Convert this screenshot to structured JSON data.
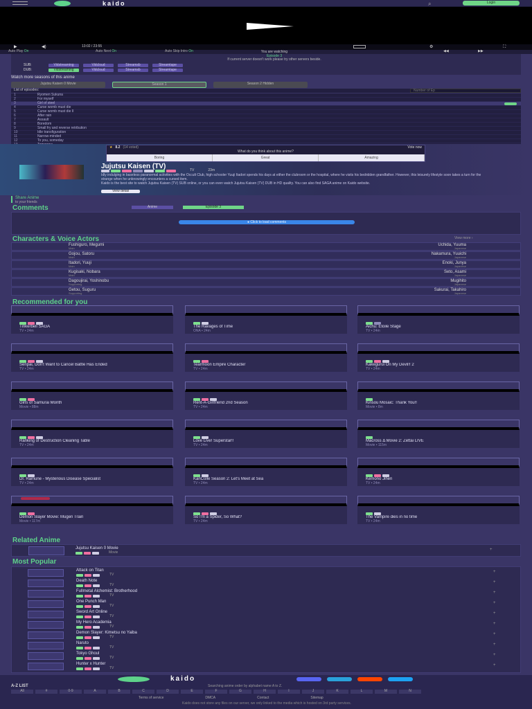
{
  "header": {
    "logo": "kaido",
    "login": "Login"
  },
  "player": {
    "time": "13:02 / 23:55"
  },
  "autobar": {
    "auto_play": "Auto Play",
    "auto_play_val": "On",
    "auto_next": "Auto Next",
    "auto_next_val": "On",
    "auto_skip": "Auto Skip Intro",
    "auto_skip_val": "On"
  },
  "servers": {
    "watching": "You are watching",
    "episode": "Episode 3",
    "note": "If current server doesn't work please try other servers beside.",
    "sub_label": "SUB:",
    "dub_label": "DUB:",
    "sub": [
      "Vidstreaming",
      "Vidcloud",
      "Streamsb",
      "Streamtape"
    ],
    "dub": [
      "Vidstreaming",
      "Vidcloud",
      "Streamsb",
      "Streamtape"
    ]
  },
  "seasons": {
    "title": "Watch more seasons of this anime",
    "items": [
      "Jujutsu Kaisen 0 Movie",
      "Season 1",
      "Season 2 Hidden"
    ]
  },
  "episodes": {
    "title": "List of episodes:",
    "search_placeholder": "Number of Ep",
    "items": [
      {
        "n": "1",
        "t": "Ryomen Sukuna"
      },
      {
        "n": "2",
        "t": "For myself"
      },
      {
        "n": "3",
        "t": "Girl of steel"
      },
      {
        "n": "4",
        "t": "Curse womb must die"
      },
      {
        "n": "5",
        "t": "Curse womb must die II"
      },
      {
        "n": "6",
        "t": "After rain"
      },
      {
        "n": "7",
        "t": "Assault"
      },
      {
        "n": "8",
        "t": "Boredom"
      },
      {
        "n": "9",
        "t": "Small fry and reverse retribution"
      },
      {
        "n": "10",
        "t": "Idle transfiguration"
      },
      {
        "n": "11",
        "t": "Narrow-minded"
      },
      {
        "n": "12",
        "t": "To you, someday"
      },
      {
        "n": "13",
        "t": "Tomorrow"
      },
      {
        "n": "14",
        "t": "Kyoto sister school exchange event - group battle 0 -"
      }
    ]
  },
  "anime": {
    "title": "Jujutsu Kaisen (TV)",
    "type": "TV",
    "duration": "23m",
    "desc": "Idly indulging in baseless paranormal activities with the Occult Club, high schooler Yuuji Itadori spends his days at either the clubroom or the hospital, where he visits his bedridden grandfather. However, this leisurely lifestyle soon takes a turn for the strange when he unknowingly encounters a cursed item.",
    "desc2": "Kaido is the best site to watch Jujutsu Kaisen (TV) SUB online, or you can even watch Jujutsu Kaisen (TV) DUB in HD quality. You can also find SAGA anime on Kaido website.",
    "view": "View detail"
  },
  "vote": {
    "score": "8.2",
    "voted": "(14 voted)",
    "question": "What do you think about this anime?",
    "vote_now": "Vote now",
    "options": [
      "Boring",
      "Great",
      "Amazing"
    ]
  },
  "share": {
    "label": "Share Anime",
    "sub": "to your friends"
  },
  "comments": {
    "title": "Comments",
    "tab1": "Anime",
    "tab2": "Episode 3",
    "load": "Click to load comments"
  },
  "characters": {
    "title": "Characters & Voice Actors",
    "view_more": "View more",
    "items": [
      {
        "name": "Fushiguro, Megumi",
        "role": "Main",
        "va": "Uchida, Yuuma",
        "lang": "Japanese"
      },
      {
        "name": "Gojou, Satoru",
        "role": "Main",
        "va": "Nakamura, Yuuichi",
        "lang": "Japanese"
      },
      {
        "name": "Itadori, Yuuji",
        "role": "Main",
        "va": "Enoki, Junya",
        "lang": "Japanese"
      },
      {
        "name": "Kugisaki, Nobara",
        "role": "Main",
        "va": "Seto, Asami",
        "lang": "Japanese"
      },
      {
        "name": "Dagoujirai, Yoshinobu",
        "role": "Supporting",
        "va": "Mugihito",
        "lang": "Japanese"
      },
      {
        "name": "Getou, Suguru",
        "role": "Supporting",
        "va": "Sakurai, Takahiro",
        "lang": "Japanese"
      }
    ]
  },
  "recommended": {
    "title": "Recommended for you",
    "items": [
      {
        "title": "Tinkerbell SAGA",
        "sub": "TV  •  24m"
      },
      {
        "title": "The Ravages of Time",
        "sub": "ONA  •  24m"
      },
      {
        "title": "Aichu: Etoile Stage",
        "sub": "TV  •  24m"
      },
      {
        "title": "Senpai, Don't Want to Cancel Battle Has Ended",
        "sub": "TV  •  24m"
      },
      {
        "title": "Tearmoon Empire Character",
        "sub": "TV  •  24m"
      },
      {
        "title": "Kakegurui On My Devil!! 2",
        "sub": "TV  •  24m"
      },
      {
        "title": "Girls of Samurai Month",
        "sub": "Movie  •  88m"
      },
      {
        "title": "Rent-A-Girlfriend 2nd Season",
        "sub": "TV  •  24m"
      },
      {
        "title": "Kinsou Mosaic: Thank You!!",
        "sub": "Movie  •  8m"
      },
      {
        "title": "Ranking of Destruction Cleaning Table",
        "sub": "TV  •  24m"
      },
      {
        "title": "Love Live! Superstar!!",
        "sub": "TV  •  24m"
      },
      {
        "title": "Macross Δ Movie 2: Zettai LIVE",
        "sub": "Movie  •  115m"
      },
      {
        "title": "Dr. Ramune - Mysterious Disease Specialist",
        "sub": "TV  •  24m"
      },
      {
        "title": "KanColle Season 2: Let's Meet at Sea",
        "sub": "TV  •  24m"
      },
      {
        "title": "Kemono Jihen",
        "sub": "TV  •  24m"
      },
      {
        "title": "Demon Slayer Movie: Mugen Train",
        "sub": "Movie  •  117m"
      },
      {
        "title": "So I'm a Spider, So What?",
        "sub": "TV  •  24m"
      },
      {
        "title": "The Vampire dies in no time",
        "sub": "TV  •  24m"
      }
    ]
  },
  "related": {
    "title": "Related Anime",
    "items": [
      {
        "title": "Jujutsu Kaisen 0 Movie",
        "sub": "Movie"
      }
    ]
  },
  "popular": {
    "title": "Most Popular",
    "items": [
      {
        "title": "Attack on Titan",
        "sub": "TV"
      },
      {
        "title": "Death Note",
        "sub": "TV"
      },
      {
        "title": "Fullmetal Alchemist: Brotherhood",
        "sub": "TV"
      },
      {
        "title": "One Punch Man",
        "sub": "TV"
      },
      {
        "title": "Sword Art Online",
        "sub": "TV"
      },
      {
        "title": "My Hero Academia",
        "sub": "TV"
      },
      {
        "title": "Demon Slayer: Kimetsu no Yaiba",
        "sub": "TV"
      },
      {
        "title": "Naruto",
        "sub": "TV"
      },
      {
        "title": "Tokyo Ghoul",
        "sub": "TV"
      },
      {
        "title": "Hunter x Hunter",
        "sub": "TV"
      }
    ]
  },
  "footer": {
    "logo": "kaido",
    "az_title": "A-Z LIST",
    "az_note": "Searching anime order by alphabet name A to Z.",
    "az": [
      "All",
      "#",
      "0-9",
      "A",
      "B",
      "C",
      "D",
      "E",
      "F",
      "G",
      "H",
      "I",
      "J",
      "K",
      "L",
      "M",
      "N"
    ],
    "links": [
      "Terms of service",
      "DMCA",
      "Contact",
      "Sitemap"
    ],
    "copyright": "Kaido does not store any files on our server, we only linked to the media which is hosted on 3rd party services."
  },
  "colors": {
    "accent": "#5ed28a",
    "bg": "#3a3566",
    "panel": "#2e2a52"
  }
}
